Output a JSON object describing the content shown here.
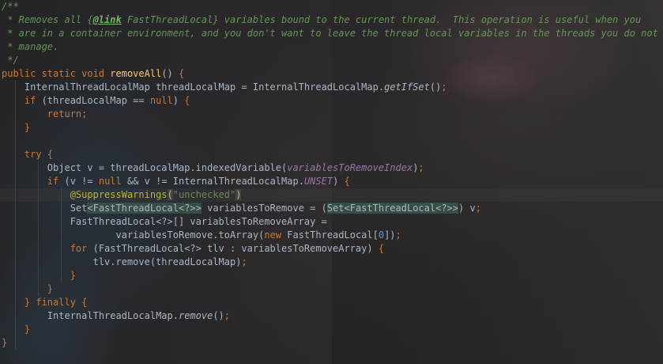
{
  "theme": {
    "comment": "#629755",
    "keyword": "#cc7832",
    "plain": "#a9b7c6",
    "method": "#ffc66d",
    "static_field": "#9876aa",
    "number": "#6897bb",
    "string": "#6a8759",
    "annotation": "#bbb529"
  },
  "code": {
    "lines": [
      [
        {
          "t": "/**",
          "c": "comment"
        }
      ],
      [
        {
          "t": " * Removes all ",
          "c": "comment"
        },
        {
          "t": "{",
          "c": "comment"
        },
        {
          "t": "@link",
          "c": "tag"
        },
        {
          "t": " FastThreadLocal} variables bound to the current thread.  This operation is useful when you",
          "c": "comment"
        }
      ],
      [
        {
          "t": " * are in a container environment, and you don't want to leave the thread local variables in the threads you do not",
          "c": "comment"
        }
      ],
      [
        {
          "t": " * manage.",
          "c": "comment"
        }
      ],
      [
        {
          "t": " */",
          "c": "comment"
        }
      ],
      [
        {
          "t": "public static void ",
          "c": "kw"
        },
        {
          "t": "removeAll",
          "c": "method"
        },
        {
          "t": "() ",
          "c": "plain"
        },
        {
          "t": "{",
          "c": "kw"
        }
      ],
      [
        {
          "t": "    InternalThreadLocalMap threadLocalMap = InternalThreadLocalMap.",
          "c": "plain"
        },
        {
          "t": "getIfSet",
          "c": "italic-plain"
        },
        {
          "t": "()",
          "c": "plain"
        },
        {
          "t": ";",
          "c": "kw"
        }
      ],
      [
        {
          "t": "    if ",
          "c": "kw"
        },
        {
          "t": "(threadLocalMap == ",
          "c": "plain"
        },
        {
          "t": "null",
          "c": "kw"
        },
        {
          "t": ") ",
          "c": "plain"
        },
        {
          "t": "{",
          "c": "kw"
        }
      ],
      [
        {
          "t": "        return;",
          "c": "kw"
        }
      ],
      [
        {
          "t": "    }",
          "c": "kw"
        }
      ],
      [
        {
          "t": "",
          "c": "plain"
        }
      ],
      [
        {
          "t": "    try ",
          "c": "kw"
        },
        {
          "t": "{",
          "c": "kw"
        }
      ],
      [
        {
          "t": "        Object v = threadLocalMap.indexedVariable(",
          "c": "plain"
        },
        {
          "t": "variablesToRemoveIndex",
          "c": "static"
        },
        {
          "t": ")",
          "c": "plain"
        },
        {
          "t": ";",
          "c": "kw"
        }
      ],
      [
        {
          "t": "        if ",
          "c": "kw"
        },
        {
          "t": "(v != ",
          "c": "plain"
        },
        {
          "t": "null ",
          "c": "kw"
        },
        {
          "t": "&& v != InternalThreadLocalMap.",
          "c": "plain"
        },
        {
          "t": "UNSET",
          "c": "static"
        },
        {
          "t": ") ",
          "c": "plain"
        },
        {
          "t": "{",
          "c": "kw"
        }
      ],
      [
        {
          "t": "            ",
          "c": "plain"
        },
        {
          "t": "@SuppressWarnings",
          "c": "anno"
        },
        {
          "t": "(",
          "c": "brace"
        },
        {
          "t": "\"unchecked\"",
          "c": "str"
        },
        {
          "t": ")",
          "c": "brace"
        }
      ],
      [
        {
          "t": "            Set",
          "c": "plain"
        },
        {
          "t": "<FastThreadLocal<?>>",
          "c": "match"
        },
        {
          "t": " variablesToRemove = (",
          "c": "plain"
        },
        {
          "t": "Set<FastThreadLocal<?>>",
          "c": "match"
        },
        {
          "t": ") v",
          "c": "plain"
        },
        {
          "t": ";",
          "c": "kw"
        }
      ],
      [
        {
          "t": "            FastThreadLocal<?>[] variablesToRemoveArray =",
          "c": "plain"
        }
      ],
      [
        {
          "t": "                    variablesToRemove.toArray(",
          "c": "plain"
        },
        {
          "t": "new ",
          "c": "kw"
        },
        {
          "t": "FastThreadLocal[",
          "c": "plain"
        },
        {
          "t": "0",
          "c": "num"
        },
        {
          "t": "])",
          "c": "plain"
        },
        {
          "t": ";",
          "c": "kw"
        }
      ],
      [
        {
          "t": "            for ",
          "c": "kw"
        },
        {
          "t": "(FastThreadLocal<?> tlv : variablesToRemoveArray) ",
          "c": "plain"
        },
        {
          "t": "{",
          "c": "kw"
        }
      ],
      [
        {
          "t": "                tlv.remove(threadLocalMap)",
          "c": "plain"
        },
        {
          "t": ";",
          "c": "kw"
        }
      ],
      [
        {
          "t": "            }",
          "c": "kw"
        }
      ],
      [
        {
          "t": "        }",
          "c": "kw"
        }
      ],
      [
        {
          "t": "    } ",
          "c": "kw"
        },
        {
          "t": "finally ",
          "c": "kw"
        },
        {
          "t": "{",
          "c": "kw"
        }
      ],
      [
        {
          "t": "        InternalThreadLocalMap.",
          "c": "plain"
        },
        {
          "t": "remove",
          "c": "italic-plain"
        },
        {
          "t": "()",
          "c": "plain"
        },
        {
          "t": ";",
          "c": "kw"
        }
      ],
      [
        {
          "t": "    }",
          "c": "kw"
        }
      ],
      [
        {
          "t": "}",
          "c": "kw"
        }
      ]
    ]
  }
}
